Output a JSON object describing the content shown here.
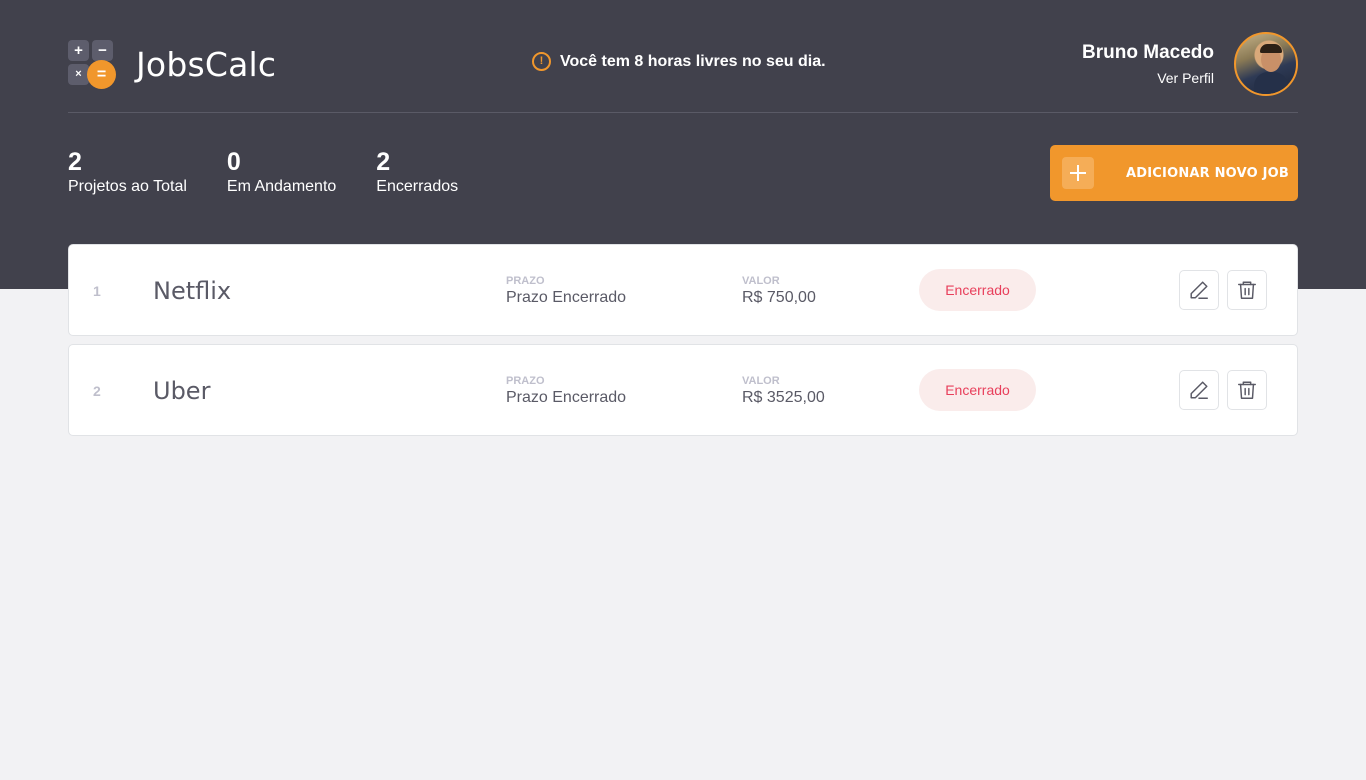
{
  "header": {
    "app_name": "JobsCalc",
    "logo_glyphs": [
      "+",
      "−",
      "×",
      "="
    ],
    "notice": "Você tem 8 horas livres no seu dia.",
    "notice_icon": "!",
    "profile": {
      "name": "Bruno Macedo",
      "link": "Ver Perfil"
    }
  },
  "stats": [
    {
      "value": "2",
      "label": "Projetos ao Total"
    },
    {
      "value": "0",
      "label": "Em Andamento"
    },
    {
      "value": "2",
      "label": "Encerrados"
    }
  ],
  "add_button": {
    "label": "ADICIONAR NOVO JOB"
  },
  "jobs": [
    {
      "id": "1",
      "name": "Netflix",
      "prazo_label": "PRAZO",
      "prazo": "Prazo Encerrado",
      "valor_label": "VALOR",
      "valor": "R$ 750,00",
      "status": "Encerrado"
    },
    {
      "id": "2",
      "name": "Uber",
      "prazo_label": "PRAZO",
      "prazo": "Prazo Encerrado",
      "valor_label": "VALOR",
      "valor": "R$ 3525,00",
      "status": "Encerrado"
    }
  ],
  "colors": {
    "header_bg": "#41414C",
    "accent": "#F1972C",
    "page_bg": "#F2F2F4",
    "status_closed_text": "#E83F5B",
    "status_closed_bg": "#FAECEB"
  },
  "icons": {
    "notice": "alert-circle-icon",
    "add": "plus-icon",
    "edit": "pencil-icon",
    "delete": "trash-icon"
  }
}
